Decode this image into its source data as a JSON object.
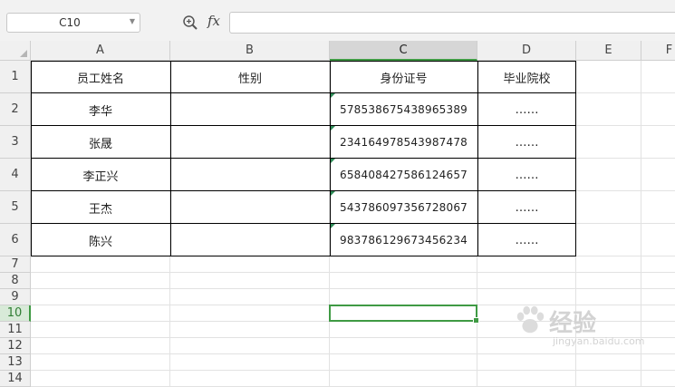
{
  "formula_bar": {
    "name_box": "C10",
    "fx_label": "fx",
    "formula_value": ""
  },
  "columns": [
    "A",
    "B",
    "C",
    "D",
    "E",
    "F"
  ],
  "rows": [
    "1",
    "2",
    "3",
    "4",
    "5",
    "6",
    "7",
    "8",
    "9",
    "10",
    "11",
    "12",
    "13",
    "14"
  ],
  "selected_cell": "C10",
  "table": {
    "headers": [
      "员工姓名",
      "性别",
      "身份证号",
      "毕业院校"
    ],
    "rows": [
      {
        "name": "李华",
        "gender": "",
        "id": "578538675438965389",
        "school": "……"
      },
      {
        "name": "张晟",
        "gender": "",
        "id": "234164978543987478",
        "school": "……"
      },
      {
        "name": "李正兴",
        "gender": "",
        "id": "658408427586124657",
        "school": "……"
      },
      {
        "name": "王杰",
        "gender": "",
        "id": "543786097356728067",
        "school": "……"
      },
      {
        "name": "陈兴",
        "gender": "",
        "id": "983786129673456234",
        "school": "……"
      }
    ]
  },
  "watermark": {
    "brand": "经验",
    "url": "jingyan.baidu.com"
  },
  "colors": {
    "accent": "#3f9a44",
    "header_bg": "#f0f0f0",
    "text_triangle": "#2e8b57"
  }
}
